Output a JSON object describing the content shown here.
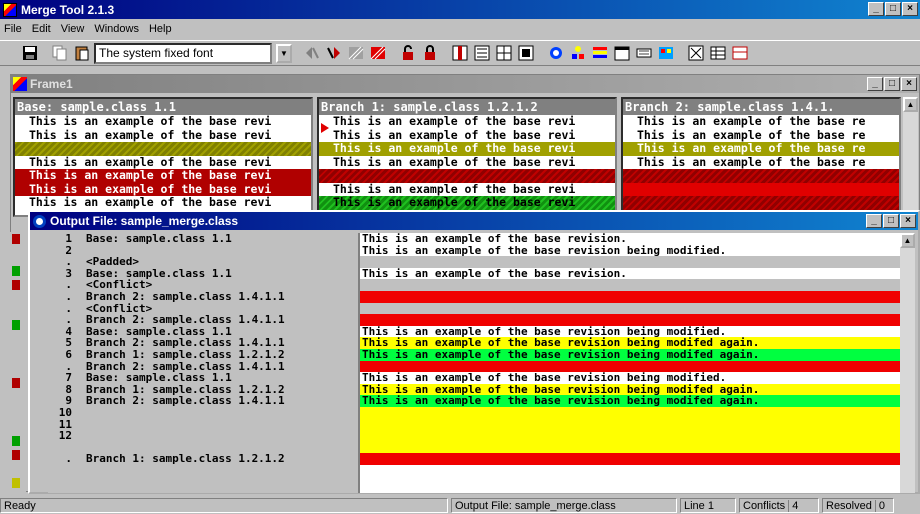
{
  "app": {
    "title": "Merge Tool 2.1.3"
  },
  "menu": [
    "File",
    "Edit",
    "View",
    "Windows",
    "Help"
  ],
  "toolbar": {
    "font_value": "The system fixed font"
  },
  "frame1": {
    "title": "Frame1",
    "panes": [
      {
        "header": "Base:  sample.class 1.1",
        "lines": [
          {
            "text": "This is an example of the base revi",
            "style": "plain"
          },
          {
            "text": "This is an example of the base revi",
            "style": "plain"
          },
          {
            "text": "",
            "style": "hatch-olive"
          },
          {
            "text": "This is an example of the base revi",
            "style": "plain"
          },
          {
            "text": "This is an example of the base revi",
            "style": "red-text"
          },
          {
            "text": "This is an example of the base revi",
            "style": "red-text"
          },
          {
            "text": "This is an example of the base revi",
            "style": "plain"
          }
        ]
      },
      {
        "header": "Branch 1:  sample.class 1.2.1.2",
        "lines": [
          {
            "text": "This is an example of the base revi",
            "style": "plain"
          },
          {
            "text": "This is an example of the base revi",
            "style": "plain"
          },
          {
            "text": "This is an example of the base revi",
            "style": "olive-text"
          },
          {
            "text": "This is an example of the base revi",
            "style": "plain"
          },
          {
            "text": "",
            "style": "hatch-red"
          },
          {
            "text": "This is an example of the base revi",
            "style": "plain"
          },
          {
            "text": "This is an example of the base revi",
            "style": "hatch-green"
          }
        ]
      },
      {
        "header": "Branch 2:  sample.class 1.4.1.",
        "lines": [
          {
            "text": "This is an example of the base re",
            "style": "plain"
          },
          {
            "text": "This is an example of the base re",
            "style": "plain"
          },
          {
            "text": "This is an example of the base re",
            "style": "olive-text"
          },
          {
            "text": "This is an example of the base re",
            "style": "plain"
          },
          {
            "text": "",
            "style": "hatch-red"
          },
          {
            "text": "",
            "style": "solid-red"
          },
          {
            "text": "",
            "style": "hatch-red"
          }
        ]
      }
    ]
  },
  "output": {
    "title": "Output File:  sample_merge.class",
    "rows": [
      {
        "num": "1",
        "label": "Base:  sample.class 1.1",
        "text": "This is an example of the base revision.",
        "bg": "white"
      },
      {
        "num": "2",
        "label": "",
        "text": "This is an example of the base revision being modified.",
        "bg": "white"
      },
      {
        "num": ".",
        "label": "<Padded>",
        "text": "",
        "bg": "gray"
      },
      {
        "num": "3",
        "label": "Base:  sample.class 1.1",
        "text": "This is an example of the base revision.",
        "bg": "white"
      },
      {
        "num": ".",
        "label": "<Conflict>",
        "text": "",
        "bg": "gray"
      },
      {
        "num": ".",
        "label": "Branch 2:  sample.class 1.4.1.1",
        "text": "",
        "bg": "red"
      },
      {
        "num": ".",
        "label": "<Conflict>",
        "text": "",
        "bg": "gray"
      },
      {
        "num": ".",
        "label": "Branch 2:  sample.class 1.4.1.1",
        "text": "",
        "bg": "red"
      },
      {
        "num": "4",
        "label": "Base:  sample.class 1.1",
        "text": "This is an example of the base revision being modified.",
        "bg": "white"
      },
      {
        "num": "5",
        "label": "Branch 2:  sample.class 1.4.1.1",
        "text": "This is an example of the base revision being modifed again.",
        "bg": "yellow"
      },
      {
        "num": "6",
        "label": "Branch 1:  sample.class 1.2.1.2",
        "text": "This is an example of the base revision being modifed again.",
        "bg": "green"
      },
      {
        "num": ".",
        "label": "Branch 2:  sample.class 1.4.1.1",
        "text": "",
        "bg": "red"
      },
      {
        "num": "7",
        "label": "Base:  sample.class 1.1",
        "text": "This is an example of the base revision being modified.",
        "bg": "white"
      },
      {
        "num": "8",
        "label": "Branch 1:  sample.class 1.2.1.2",
        "text": "This is an example of the base revision being modifed again.",
        "bg": "yellow"
      },
      {
        "num": "9",
        "label": "Branch 2:  sample.class 1.4.1.1",
        "text": "This is an example of the base revision being modifed again.",
        "bg": "green"
      },
      {
        "num": "10",
        "label": "",
        "text": "",
        "bg": "yellow"
      },
      {
        "num": "11",
        "label": "",
        "text": "",
        "bg": "yellow"
      },
      {
        "num": "12",
        "label": "",
        "text": "",
        "bg": "yellow"
      },
      {
        "num": "",
        "label": "",
        "text": "",
        "bg": "yellow"
      },
      {
        "num": ".",
        "label": "Branch 1:  sample.class 1.2.1.2",
        "text": "",
        "bg": "red"
      }
    ]
  },
  "status": {
    "ready": "Ready",
    "output_file": "Output File:  sample_merge.class",
    "line": "Line 1",
    "conflicts_label": "Conflicts",
    "conflicts_value": "4",
    "resolved_label": "Resolved",
    "resolved_value": "0"
  },
  "window_buttons": {
    "minimize": "_",
    "maximize": "□",
    "close": "×"
  },
  "colors": {
    "title_active": "#000080",
    "conflict": "#f00000",
    "branch1": "#00ff40",
    "branch2": "#ffff00"
  }
}
